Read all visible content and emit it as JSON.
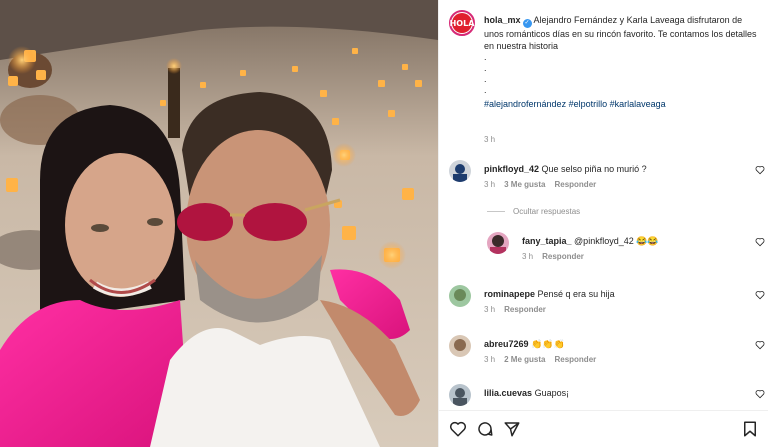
{
  "post": {
    "username": "hola_mx",
    "logo_text": "¡HOLA!",
    "caption": "Alejandro Fernández y Karla Laveaga disfrutaron de unos románticos días en su rincón favorito. Te contamos los detalles en nuestra historia",
    "dots": [
      ".",
      ".",
      ".",
      "."
    ],
    "hashtags": "#alejandrofernández #elpotrillo #karlalaveaga",
    "time": "3 h"
  },
  "comments": [
    {
      "user": "pinkfloyd_42",
      "text": "Que selso piña no murió ?",
      "time": "3 h",
      "likes": "3 Me gusta",
      "reply": "Responder"
    },
    {
      "user": "fany_tapia_",
      "text": "@pinkfloyd_42 😂😂",
      "time": "3 h",
      "likes": "",
      "reply": "Responder"
    },
    {
      "user": "rominapepe",
      "text": "Pensé q era su hija",
      "time": "3 h",
      "likes": "",
      "reply": "Responder"
    },
    {
      "user": "abreu7269",
      "text": "👏👏👏",
      "time": "3 h",
      "likes": "2 Me gusta",
      "reply": "Responder"
    },
    {
      "user": "lilia.cuevas",
      "text": "Guapos¡",
      "time": "",
      "likes": "",
      "reply": ""
    }
  ],
  "hide_replies": "Ocultar respuestas",
  "icons": [
    "heart-icon",
    "comment-icon",
    "share-icon",
    "bookmark-icon"
  ],
  "colors": {
    "verified": "#3897f0",
    "hashtag": "#00376b",
    "meta": "#8e8e8e",
    "brand": "#e0202e"
  }
}
